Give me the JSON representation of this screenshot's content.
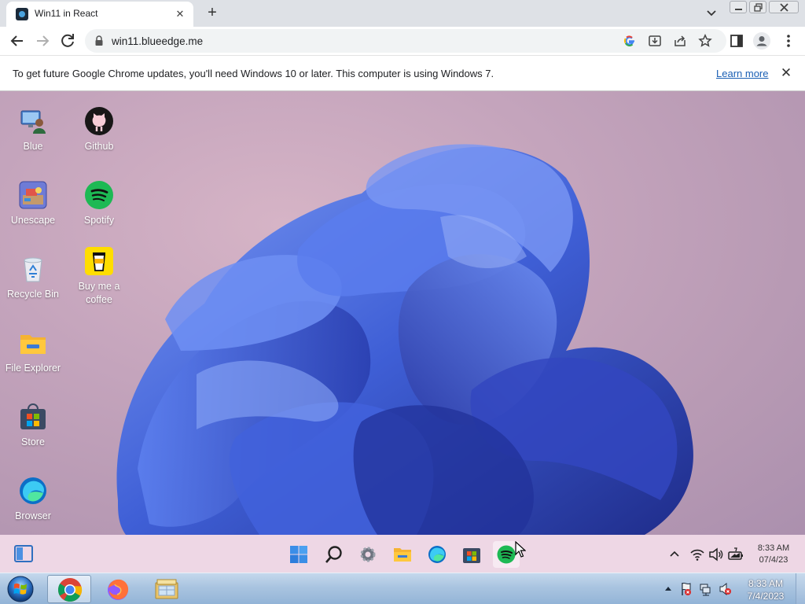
{
  "browser": {
    "tab_title": "Win11 in React",
    "tab_close": "✕",
    "new_tab": "+",
    "url": "win11.blueedge.me",
    "infobar_text": "To get future Google Chrome updates, you'll need Windows 10 or later. This computer is using Windows 7.",
    "infobar_link": "Learn more",
    "infobar_close": "✕"
  },
  "desktop": {
    "icons": [
      {
        "label": "Blue",
        "icon": "computer-user-icon"
      },
      {
        "label": "Github",
        "icon": "github-icon"
      },
      {
        "label": "Unescape",
        "icon": "unescape-game-icon"
      },
      {
        "label": "Spotify",
        "icon": "spotify-icon"
      },
      {
        "label": "Recycle Bin",
        "icon": "recycle-bin-icon"
      },
      {
        "label": "Buy me a coffee",
        "icon": "coffee-cup-icon"
      },
      {
        "label": "File Explorer",
        "icon": "folder-icon"
      },
      {
        "label": "Store",
        "icon": "store-icon"
      },
      {
        "label": "Browser",
        "icon": "edge-icon"
      }
    ]
  },
  "win11_taskbar": {
    "apps": [
      "start-icon",
      "search-icon",
      "settings-icon",
      "folder-icon",
      "edge-icon",
      "store-icon",
      "spotify-icon"
    ],
    "tray": [
      "chevron-up-icon",
      "wifi-icon",
      "volume-icon",
      "battery-icon"
    ],
    "time": "8:33 AM",
    "date": "07/4/23"
  },
  "win7_taskbar": {
    "pinned": [
      "chrome-icon",
      "firefox-icon",
      "windows-explorer-icon"
    ],
    "time": "8:33 AM",
    "date": "7/4/2023"
  },
  "colors": {
    "wallpaper_bloom": "#3f5fd6",
    "spotify_green": "#1db954",
    "link_blue": "#1a5fb4"
  }
}
